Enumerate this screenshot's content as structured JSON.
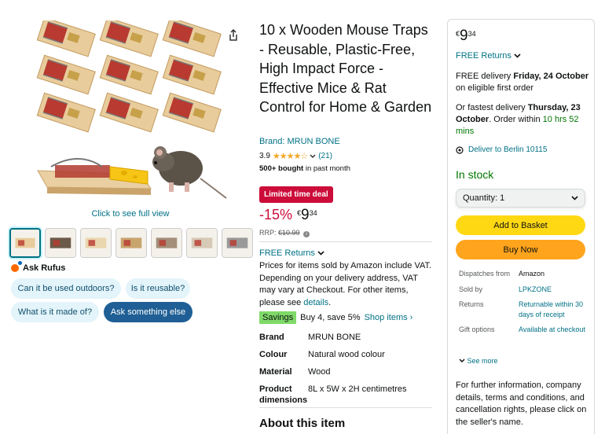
{
  "gallery": {
    "full_view_label": "Click to see full view",
    "thumbnail_count": 7
  },
  "rufus": {
    "title": "Ask Rufus",
    "chips": [
      "Can it be used outdoors?",
      "Is it reusable?",
      "What is it made of?"
    ],
    "ask_label": "Ask something else"
  },
  "product": {
    "title": "10 x Wooden Mouse Traps - Reusable, Plastic-Free, High Impact Force - Effective Mice & Rat Control for Home & Garden",
    "brand_label": "Brand: MRUN BONE",
    "rating": "3.9",
    "stars": "★★★★☆",
    "rating_count": "(21)",
    "bought_bold": "500+ bought",
    "bought_rest": " in past month"
  },
  "deal": {
    "badge": "Limited time deal",
    "discount": "-15%",
    "currency": "€",
    "price_whole": "9",
    "price_fraction": "34",
    "rrp_label": "RRP: ",
    "rrp_value": "€10.99"
  },
  "returns": {
    "label": "FREE Returns"
  },
  "vat": {
    "text": "Prices for items sold by Amazon include VAT. Depending on your delivery address, VAT may vary at Checkout. For other items, please see ",
    "link": "details",
    "end": "."
  },
  "savings": {
    "badge": "Savings",
    "text": "Buy 4, save 5%",
    "link": "Shop items ›"
  },
  "specs": [
    {
      "key": "Brand",
      "value": "MRUN BONE"
    },
    {
      "key": "Colour",
      "value": "Natural wood colour"
    },
    {
      "key": "Material",
      "value": "Wood"
    },
    {
      "key": "Product dimensions",
      "value": "8L x 5W x 2H centimetres"
    }
  ],
  "about_heading": "About this item",
  "buybox": {
    "currency": "€",
    "price_whole": "9",
    "price_fraction": "34",
    "returns": "FREE Returns",
    "delivery_prefix": "FREE delivery ",
    "delivery_date": "Friday, 24 October",
    "delivery_suffix": " on eligible first order",
    "fastest_prefix": "Or fastest delivery ",
    "fastest_date": "Thursday, 23 October",
    "fastest_mid": ". Order within ",
    "fastest_time": "10 hrs 52 mins",
    "location": "Deliver to Berlin 10115",
    "stock": "In stock",
    "quantity": "Quantity: 1",
    "add_to_basket": "Add to Basket",
    "buy_now": "Buy Now",
    "seller_rows": [
      {
        "key": "Dispatches from",
        "value": "Amazon",
        "link": false
      },
      {
        "key": "Sold by",
        "value": "LPKZONE",
        "link": true
      },
      {
        "key": "Returns",
        "value": "Returnable within 30 days of receipt",
        "link": true
      },
      {
        "key": "Gift options",
        "value": "Available at checkout",
        "link": true
      }
    ],
    "see_more": "See more",
    "further_info": "For further information, company details, terms and conditions, and cancellation rights, please click on the seller's name."
  },
  "colors": {
    "link": "#007185",
    "deal_red": "#cc0c39",
    "basket_yellow": "#ffd814",
    "buy_orange": "#ffa41c",
    "stock_green": "#007600",
    "savings_green": "#7fda69"
  }
}
